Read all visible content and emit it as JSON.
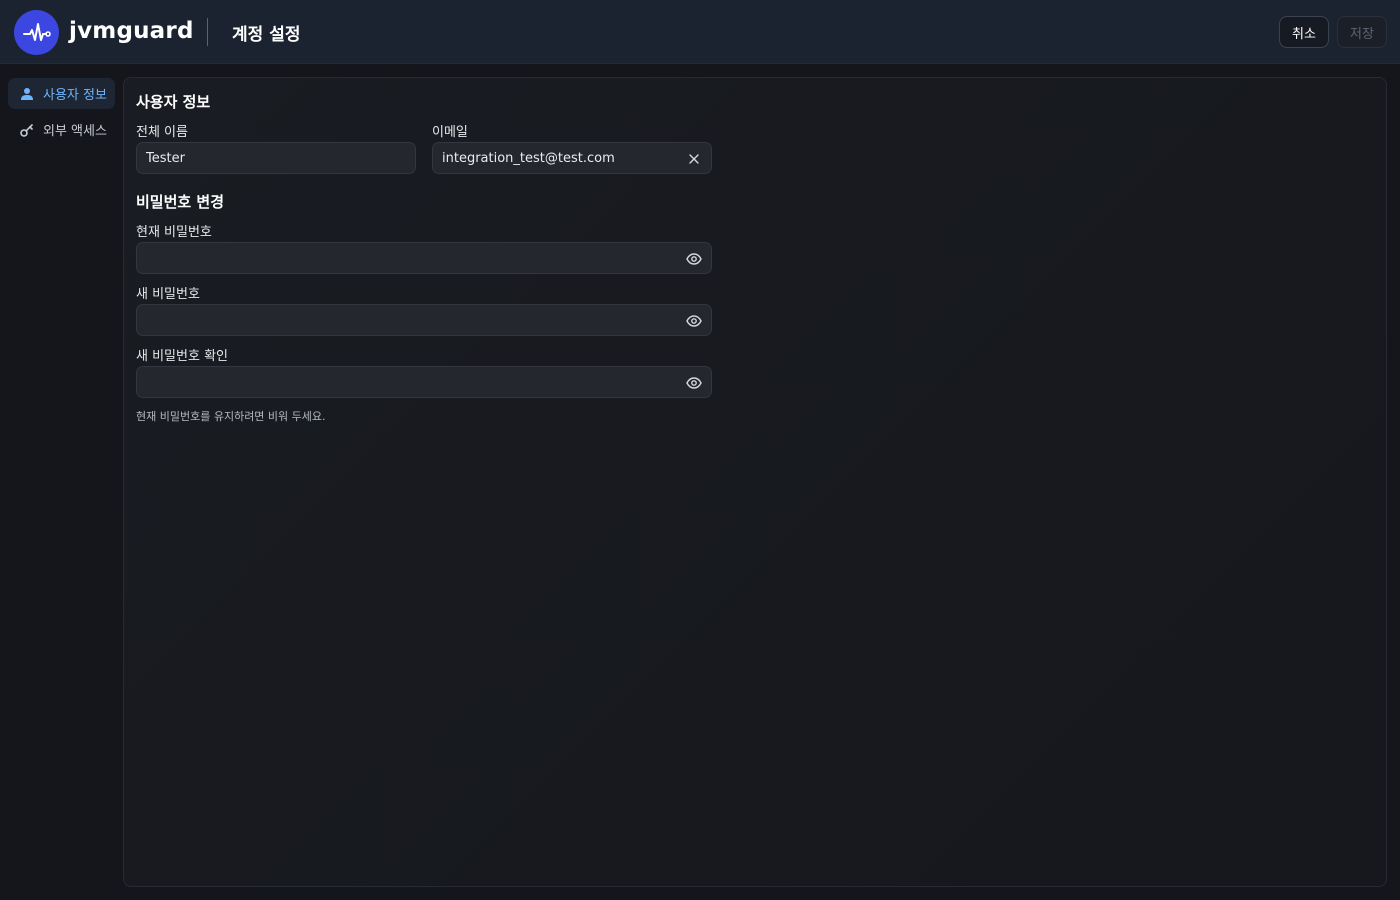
{
  "header": {
    "brand": "jvmguard",
    "title": "계정 설정",
    "cancel_label": "취소",
    "save_label": "저장",
    "logo_icon": "pulse-icon"
  },
  "sidebar": {
    "items": [
      {
        "label": "사용자 정보",
        "icon": "user-icon",
        "active": true
      },
      {
        "label": "외부 액세스",
        "icon": "key-icon",
        "active": false
      }
    ]
  },
  "main": {
    "user_section_title": "사용자 정보",
    "full_name": {
      "label": "전체 이름",
      "value": "Tester"
    },
    "email": {
      "label": "이메일",
      "value": "integration_test@test.com",
      "trailing_icon": "clear-icon"
    },
    "password_section_title": "비밀번호 변경",
    "current_password": {
      "label": "현재 비밀번호",
      "value": "",
      "trailing_icon": "eye-icon"
    },
    "new_password": {
      "label": "새 비밀번호",
      "value": "",
      "trailing_icon": "eye-icon"
    },
    "confirm_password": {
      "label": "새 비밀번호 확인",
      "value": "",
      "trailing_icon": "eye-icon"
    },
    "hint": "현재 비밀번호를 유지하려면 비워 두세요."
  },
  "colors": {
    "accent": "#3b47e0",
    "active_text": "#6cb6ff",
    "header_bg": "#1c2330",
    "panel_bg": "#191c22"
  }
}
